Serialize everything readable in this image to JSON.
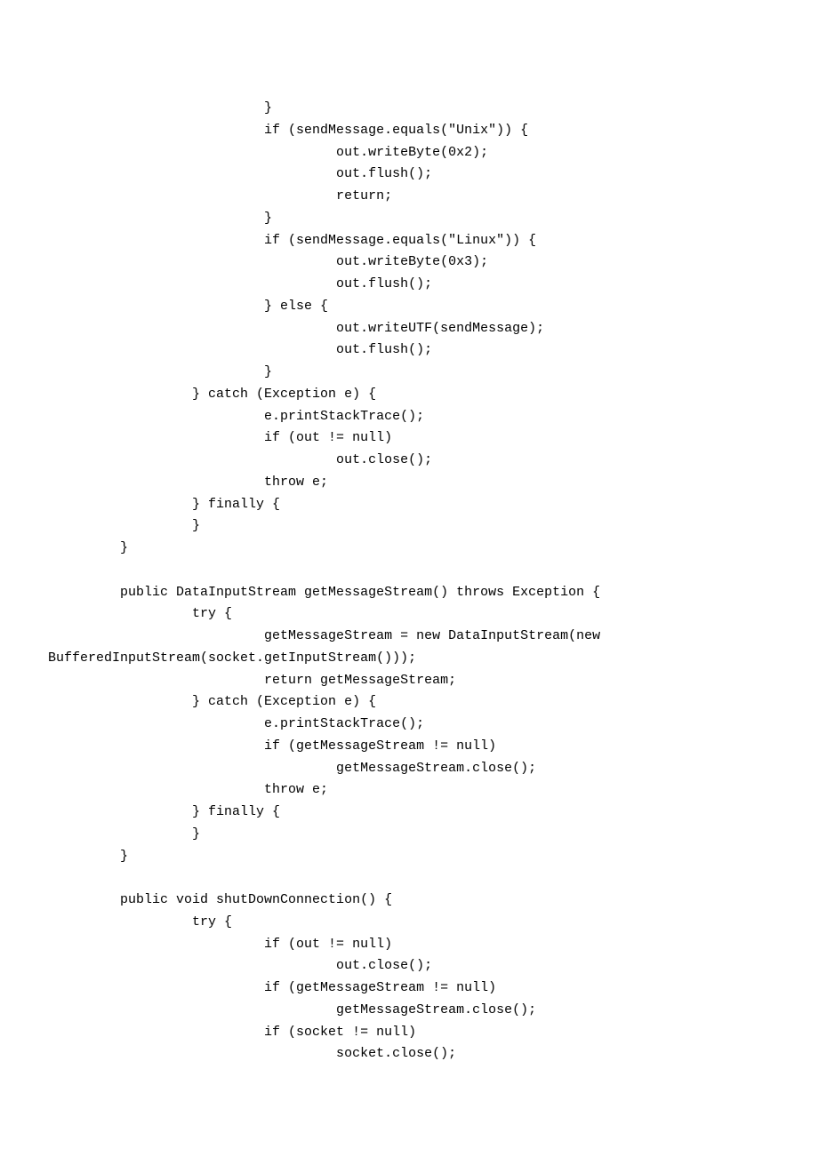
{
  "lines": [
    "                                 }",
    "                                 if (sendMessage.equals(\"Unix\")) {",
    "                                          out.writeByte(0x2);",
    "                                          out.flush();",
    "                                          return;",
    "                                 }",
    "                                 if (sendMessage.equals(\"Linux\")) {",
    "                                          out.writeByte(0x3);",
    "                                          out.flush();",
    "                                 } else {",
    "                                          out.writeUTF(sendMessage);",
    "                                          out.flush();",
    "                                 }",
    "                        } catch (Exception e) {",
    "                                 e.printStackTrace();",
    "                                 if (out != null)",
    "                                          out.close();",
    "                                 throw e;",
    "                        } finally {",
    "                        }",
    "               }",
    "",
    "               public DataInputStream getMessageStream() throws Exception {",
    "                        try {",
    "                                 getMessageStream = new DataInputStream(new",
    "      BufferedInputStream(socket.getInputStream()));",
    "                                 return getMessageStream;",
    "                        } catch (Exception e) {",
    "                                 e.printStackTrace();",
    "                                 if (getMessageStream != null)",
    "                                          getMessageStream.close();",
    "                                 throw e;",
    "                        } finally {",
    "                        }",
    "               }",
    "",
    "               public void shutDownConnection() {",
    "                        try {",
    "                                 if (out != null)",
    "                                          out.close();",
    "                                 if (getMessageStream != null)",
    "                                          getMessageStream.close();",
    "                                 if (socket != null)",
    "                                          socket.close();"
  ]
}
